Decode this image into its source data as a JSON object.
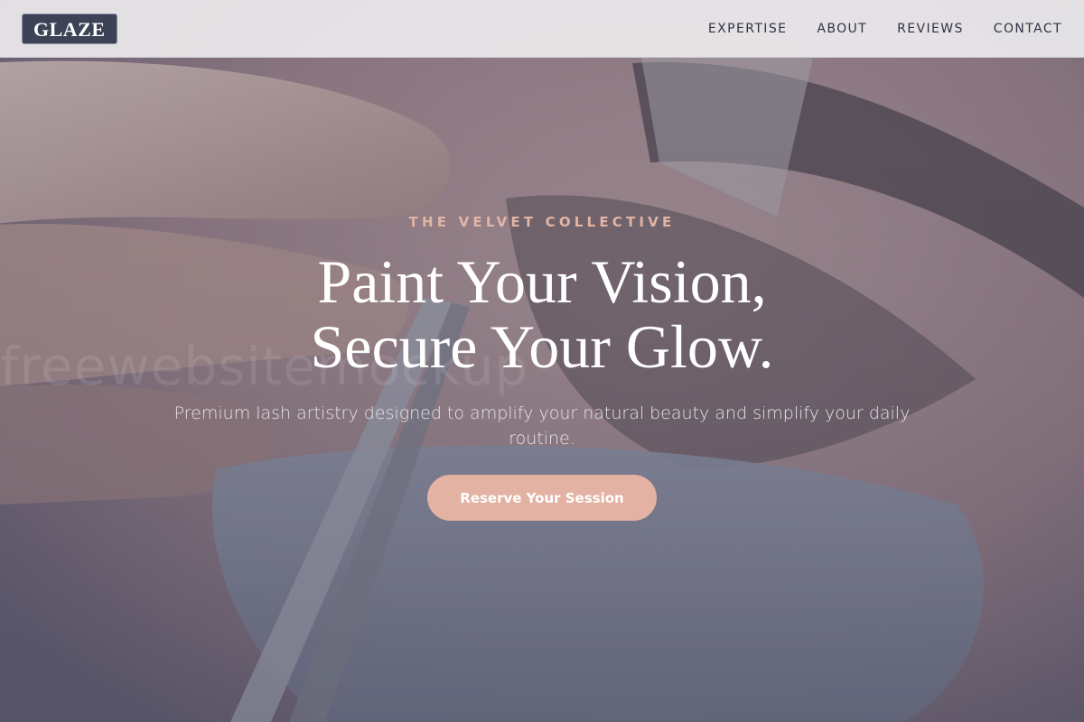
{
  "brand": {
    "logo_text": "GLAZE"
  },
  "nav": {
    "items": [
      {
        "label": "EXPERTISE"
      },
      {
        "label": "ABOUT"
      },
      {
        "label": "REVIEWS"
      },
      {
        "label": "CONTACT"
      }
    ]
  },
  "hero": {
    "eyebrow": "THE VELVET COLLECTIVE",
    "headline_line1": "Paint Your Vision,",
    "headline_line2": "Secure Your Glow.",
    "subtext": "Premium lash artistry designed to amplify your natural beauty and simplify your daily routine.",
    "cta_label": "Reserve Your Session",
    "background_image": "lash-application-closeup",
    "watermark_text": "freewebsitemockup"
  },
  "colors": {
    "accent": "#e3b2a2",
    "eyebrow": "#e2b4a4",
    "logo_bg": "#3d4356",
    "nav_text": "#2f3344",
    "header_bg": "#eceaec"
  }
}
